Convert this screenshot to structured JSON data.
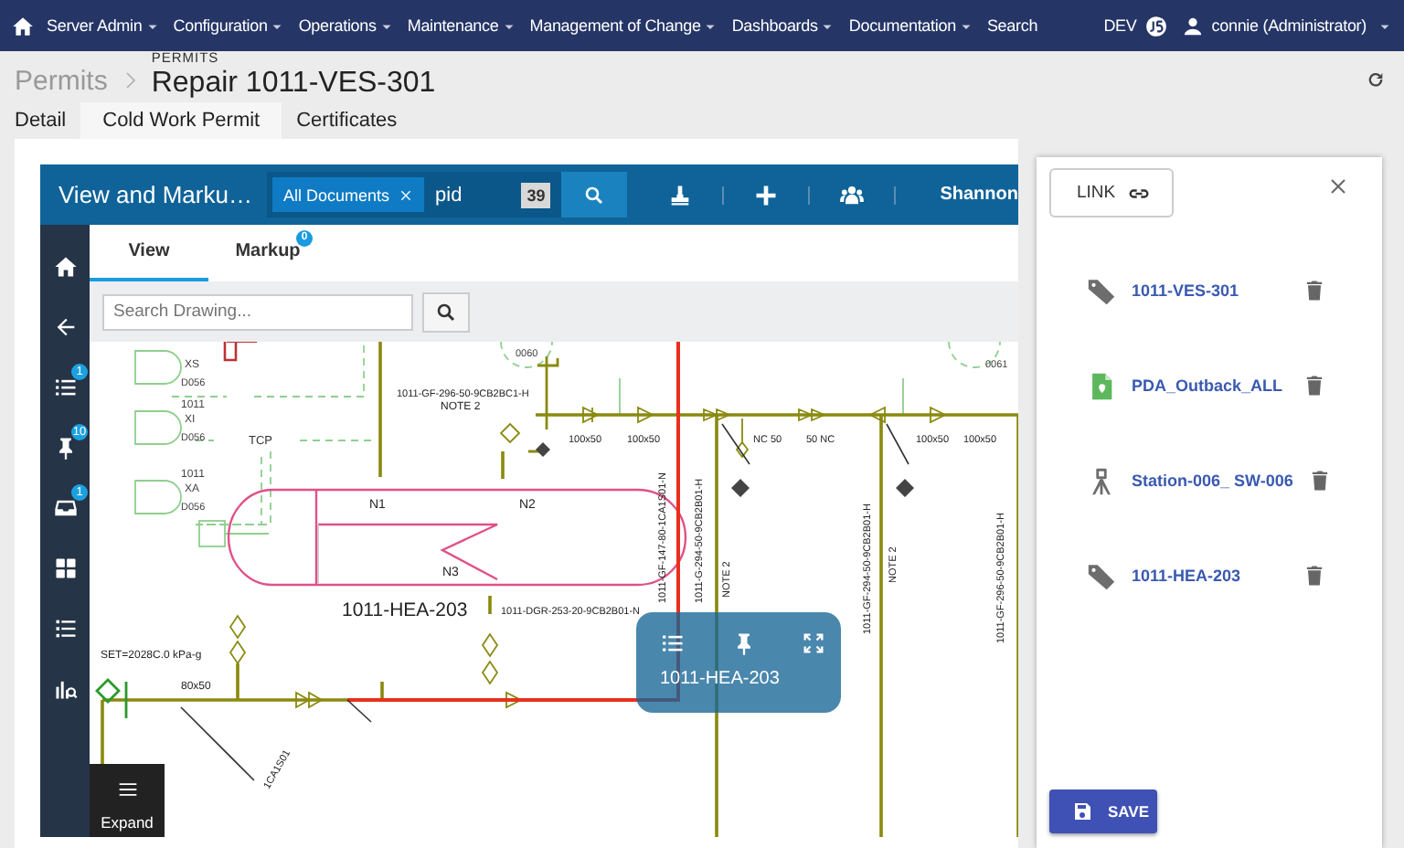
{
  "nav": {
    "items": [
      {
        "label": "Server Admin",
        "dropdown": true
      },
      {
        "label": "Configuration",
        "dropdown": true
      },
      {
        "label": "Operations",
        "dropdown": true
      },
      {
        "label": "Maintenance",
        "dropdown": true
      },
      {
        "label": "Management of Change",
        "dropdown": true
      },
      {
        "label": "Dashboards",
        "dropdown": true
      },
      {
        "label": "Documentation",
        "dropdown": true
      },
      {
        "label": "Search",
        "dropdown": false
      }
    ],
    "environment": "DEV",
    "user": "connie (Administrator)"
  },
  "breadcrumb": {
    "parent": "Permits",
    "caption": "PERMITS",
    "title": "Repair 1011-VES-301"
  },
  "tabs": [
    {
      "label": "Detail",
      "selected": false
    },
    {
      "label": "Cold Work Permit",
      "selected": true
    },
    {
      "label": "Certificates",
      "selected": false
    }
  ],
  "viewer": {
    "title": "View and Marku…",
    "filter_chip": "All Documents",
    "query": "pid",
    "result_count": "39",
    "user": "Shannon",
    "header_actions": [
      {
        "kind": "stamp"
      },
      {
        "kind": "plus"
      },
      {
        "kind": "group"
      }
    ],
    "rail": [
      {
        "kind": "home"
      },
      {
        "kind": "back"
      },
      {
        "kind": "list",
        "badge": "1"
      },
      {
        "kind": "pin",
        "badge": "10"
      },
      {
        "kind": "inbox",
        "badge": "1"
      },
      {
        "kind": "grid"
      },
      {
        "kind": "checklist"
      },
      {
        "kind": "analytics"
      }
    ],
    "view_tabs": [
      {
        "label": "View",
        "selected": true
      },
      {
        "label": "Markup",
        "selected": false,
        "badge": "0"
      }
    ],
    "search": {
      "placeholder": "Search Drawing..."
    },
    "expand_label": "Expand",
    "drawing_labels": [
      {
        "text": "XS"
      },
      {
        "text": "D056"
      },
      {
        "text": "1011"
      },
      {
        "text": "XI"
      },
      {
        "text": "D056"
      },
      {
        "text": "1011"
      },
      {
        "text": "XA"
      },
      {
        "text": "D056"
      },
      {
        "text": "TCP"
      },
      {
        "text": "N1"
      },
      {
        "text": "N2"
      },
      {
        "text": "N3"
      },
      {
        "text": "1011-HEA-203"
      },
      {
        "text": "1011-GF-296-50-9CB2BC1-H"
      },
      {
        "text": "NOTE 2"
      },
      {
        "text": "100x50"
      },
      {
        "text": "100x50"
      },
      {
        "text": "NC 50"
      },
      {
        "text": "50 NC"
      },
      {
        "text": "100x50"
      },
      {
        "text": "100x50"
      },
      {
        "text": "SET=2028C.0 kPa-g"
      },
      {
        "text": "80x50"
      },
      {
        "text": "1011-DGR-253-20-9CB2B01-N"
      },
      {
        "text": "1011-GF-147-80-1CA1S01-N"
      },
      {
        "text": "1011-G-294-50-9CB2B01-H"
      },
      {
        "text": "NOTE 2"
      },
      {
        "text": "1011-GF-294-50-9CB2B01-H"
      },
      {
        "text": "NOTE 2"
      },
      {
        "text": "1011-GF-296-50-9CB2B01-H"
      },
      {
        "text": "1CA1S01"
      },
      {
        "text": "0060"
      },
      {
        "text": "0061"
      }
    ],
    "popup": {
      "label": "1011-HEA-203"
    }
  },
  "links_panel": {
    "link_button": "LINK",
    "items": [
      {
        "kind": "tag",
        "label": "1011-VES-301"
      },
      {
        "kind": "document",
        "label": "PDA_Outback_ALL"
      },
      {
        "kind": "station",
        "label": "Station-006_ SW-006"
      },
      {
        "kind": "tag",
        "label": "1011-HEA-203"
      }
    ],
    "save_button": "SAVE"
  }
}
